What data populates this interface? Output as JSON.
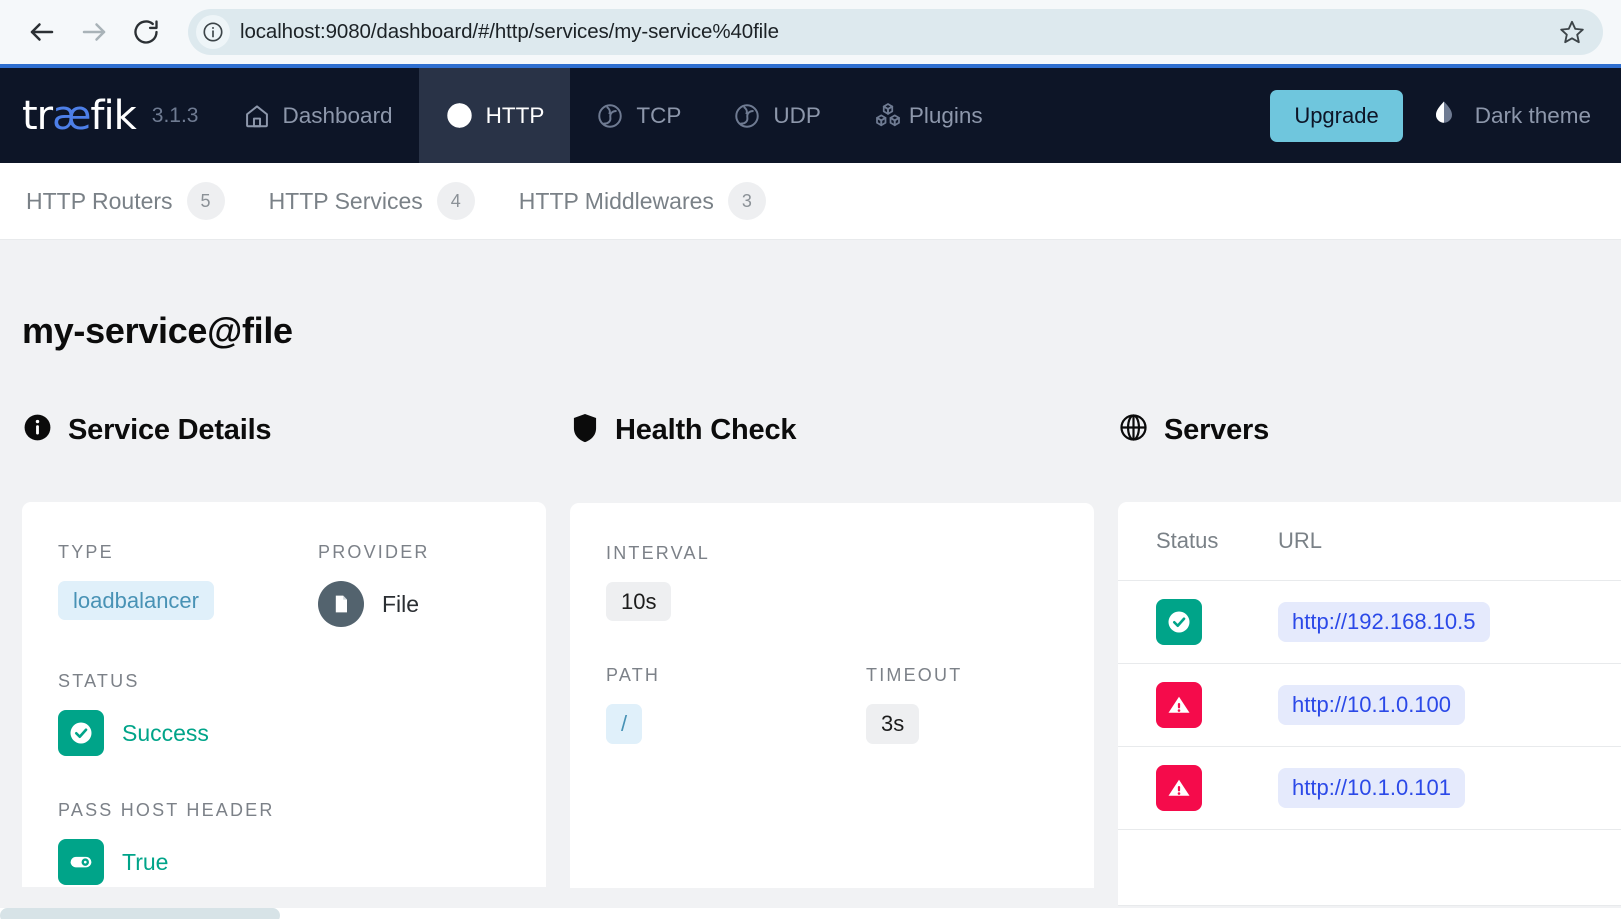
{
  "browser": {
    "url": "localhost:9080/dashboard/#/http/services/my-service%40file",
    "back_icon": "back-arrow-icon",
    "forward_icon": "forward-arrow-icon",
    "reload_icon": "reload-icon",
    "site_info_icon": "site-info-icon",
    "bookmark_icon": "star-icon"
  },
  "topnav": {
    "logo_prefix": "tr",
    "logo_ae": "æ",
    "logo_suffix": "fik",
    "version": "3.1.3",
    "items": [
      {
        "label": "Dashboard",
        "icon": "home-icon",
        "active": false
      },
      {
        "label": "HTTP",
        "icon": "globe-icon",
        "active": true
      },
      {
        "label": "TCP",
        "icon": "swoosh-icon",
        "active": false
      },
      {
        "label": "UDP",
        "icon": "swoosh-icon",
        "active": false
      },
      {
        "label": "Plugins",
        "icon": "cubes-icon",
        "active": false
      }
    ],
    "upgrade_label": "Upgrade",
    "theme_label": "Dark theme",
    "theme_icon": "droplet-half-icon",
    "accent_cyan": "#6fc6dd",
    "nav_bg": "#0d1527",
    "nav_active_bg": "#293347"
  },
  "subtabs": [
    {
      "label": "HTTP Routers",
      "count": "5"
    },
    {
      "label": "HTTP Services",
      "count": "4"
    },
    {
      "label": "HTTP Middlewares",
      "count": "3"
    }
  ],
  "page": {
    "title": "my-service@file"
  },
  "service_details": {
    "section_title": "Service Details",
    "section_icon": "info-circle-icon",
    "type_label": "TYPE",
    "type_value": "loadbalancer",
    "provider_label": "PROVIDER",
    "provider_value": "File",
    "provider_icon": "file-icon",
    "status_label": "STATUS",
    "status_value": "Success",
    "status_icon": "check-circle-icon",
    "pass_host_header_label": "PASS HOST HEADER",
    "pass_host_header_value": "True",
    "pass_host_header_icon": "toggle-on-icon"
  },
  "health_check": {
    "section_title": "Health Check",
    "section_icon": "shield-icon",
    "interval_label": "INTERVAL",
    "interval_value": "10s",
    "path_label": "PATH",
    "path_value": "/",
    "timeout_label": "TIMEOUT",
    "timeout_value": "3s"
  },
  "servers": {
    "section_title": "Servers",
    "section_icon": "globe-icon",
    "columns": [
      "Status",
      "URL"
    ],
    "rows": [
      {
        "status": "success",
        "status_icon": "check-circle-icon",
        "url": "http://192.168.10.5"
      },
      {
        "status": "error",
        "status_icon": "warning-triangle-icon",
        "url": "http://10.1.0.100"
      },
      {
        "status": "error",
        "status_icon": "warning-triangle-icon",
        "url": "http://10.1.0.101"
      }
    ]
  },
  "colors": {
    "teal": "#00a489",
    "red": "#f50b4b",
    "link_blue": "#2b49e8",
    "chip_blue_text": "#4892b5",
    "page_bg": "#f1f2f4"
  }
}
